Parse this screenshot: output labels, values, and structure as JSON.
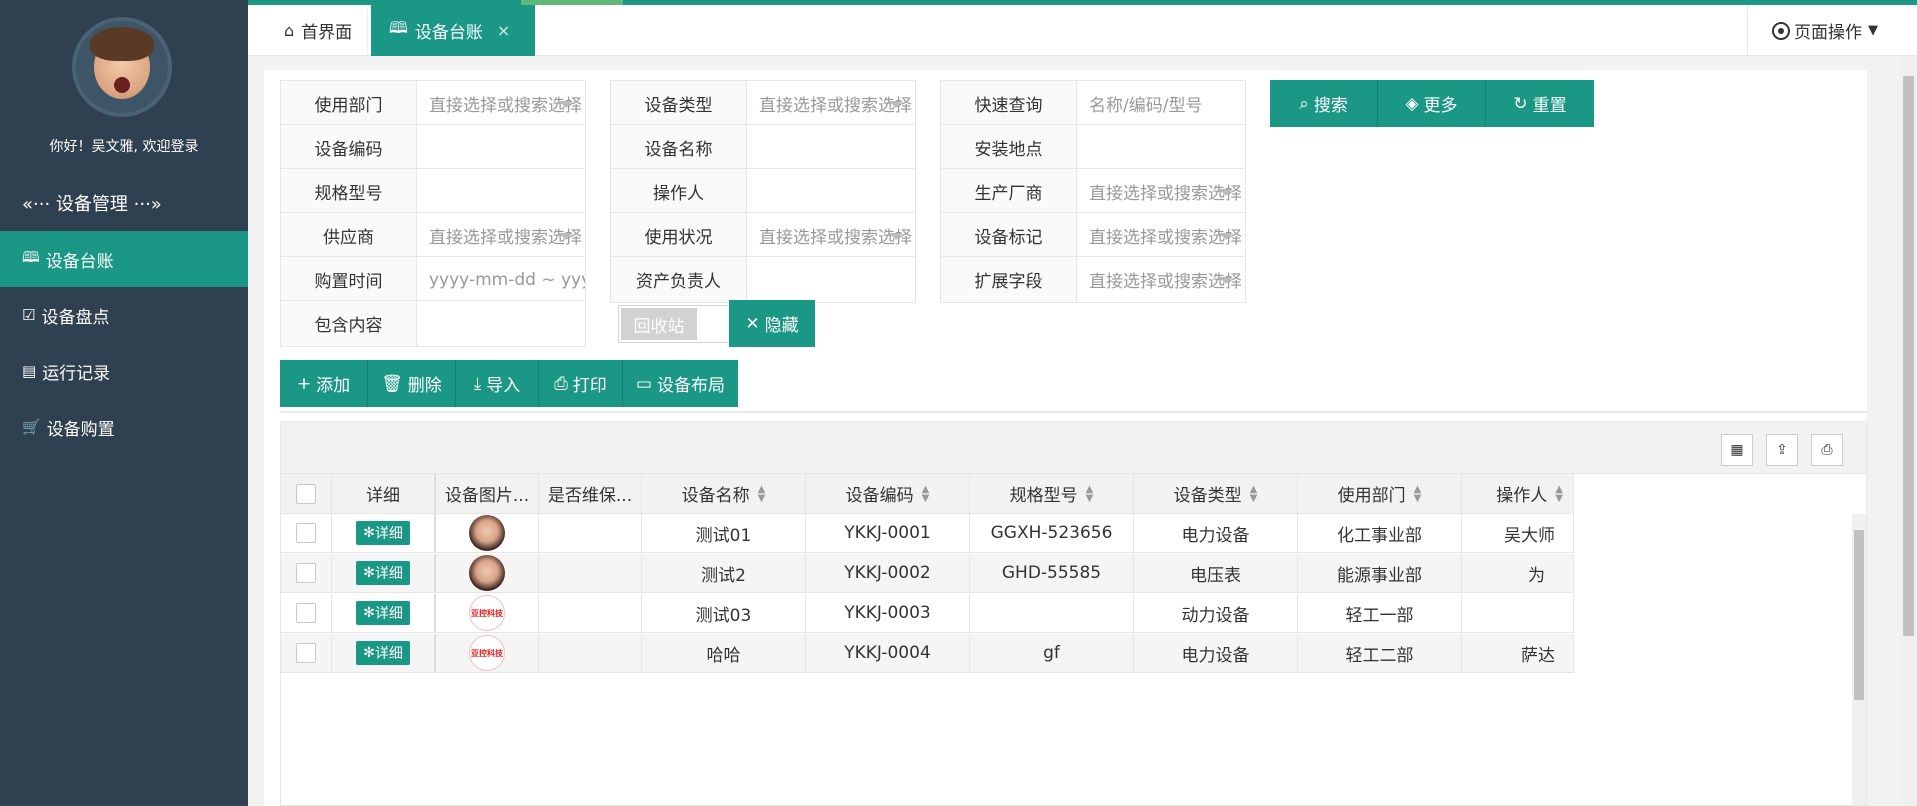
{
  "user": {
    "welcome": "你好！吴文雅, 欢迎登录"
  },
  "sidebar": {
    "group_label": "«··· 设备管理 ···»",
    "items": [
      {
        "icon": "book-icon",
        "label": "设备台账",
        "active": true
      },
      {
        "icon": "checklist-icon",
        "label": "设备盘点",
        "active": false
      },
      {
        "icon": "clipboard-icon",
        "label": "运行记录",
        "active": false
      },
      {
        "icon": "cart-icon",
        "label": "设备购置",
        "active": false
      }
    ]
  },
  "tabs": {
    "home": "首界面",
    "active": "设备台账",
    "close": "×",
    "page_op": "页面操作"
  },
  "filters": {
    "use_dept": {
      "label": "使用部门",
      "placeholder": "直接选择或搜索选择"
    },
    "type": {
      "label": "设备类型",
      "placeholder": "直接选择或搜索选择"
    },
    "quick": {
      "label": "快速查询",
      "placeholder": "名称/编码/型号"
    },
    "code": {
      "label": "设备编码",
      "value": ""
    },
    "name": {
      "label": "设备名称",
      "value": ""
    },
    "location": {
      "label": "安装地点",
      "value": ""
    },
    "model": {
      "label": "规格型号",
      "value": ""
    },
    "operator": {
      "label": "操作人",
      "value": ""
    },
    "manufacturer": {
      "label": "生产厂商",
      "placeholder": "直接选择或搜索选择"
    },
    "supplier": {
      "label": "供应商",
      "placeholder": "直接选择或搜索选择"
    },
    "status": {
      "label": "使用状况",
      "placeholder": "直接选择或搜索选择"
    },
    "mark": {
      "label": "设备标记",
      "placeholder": "直接选择或搜索选择"
    },
    "purchase_time": {
      "label": "购置时间",
      "placeholder": "yyyy-mm-dd ~ yyyy-mm-dd"
    },
    "owner": {
      "label": "资产负责人",
      "value": ""
    },
    "ext": {
      "label": "扩展字段",
      "placeholder": "直接选择或搜索选择"
    },
    "contains": {
      "label": "包含内容",
      "value": ""
    },
    "recycle": "回收站"
  },
  "search_buttons": {
    "search": "搜索",
    "more": "更多",
    "reset": "重置",
    "hide": "隐藏"
  },
  "actions": {
    "add": "添加",
    "delete": "删除",
    "import": "导入",
    "print": "打印",
    "layout": "设备布局"
  },
  "table": {
    "headers": [
      "详细",
      "设备图片...",
      "是否维保...",
      "设备名称",
      "设备编码",
      "规格型号",
      "设备类型",
      "使用部门",
      "操作人"
    ],
    "detail_label": "详细",
    "rows": [
      {
        "img": "woman",
        "maint": "",
        "name": "测试01",
        "code": "YKKJ-0001",
        "model": "GGXH-523656",
        "type": "电力设备",
        "dept": "化工事业部",
        "op": "吴大师"
      },
      {
        "img": "woman",
        "maint": "",
        "name": "测试2",
        "code": "YKKJ-0002",
        "model": "GHD-55585",
        "type": "电压表",
        "dept": "能源事业部",
        "op": "为"
      },
      {
        "img": "logo",
        "maint": "",
        "name": "测试03",
        "code": "YKKJ-0003",
        "model": "",
        "type": "动力设备",
        "dept": "轻工一部",
        "op": ""
      },
      {
        "img": "logo",
        "maint": "",
        "name": "哈哈",
        "code": "YKKJ-0004",
        "model": "gf",
        "type": "电力设备",
        "dept": "轻工二部",
        "op": "萨达"
      }
    ],
    "logo_text": "亚控科技"
  }
}
